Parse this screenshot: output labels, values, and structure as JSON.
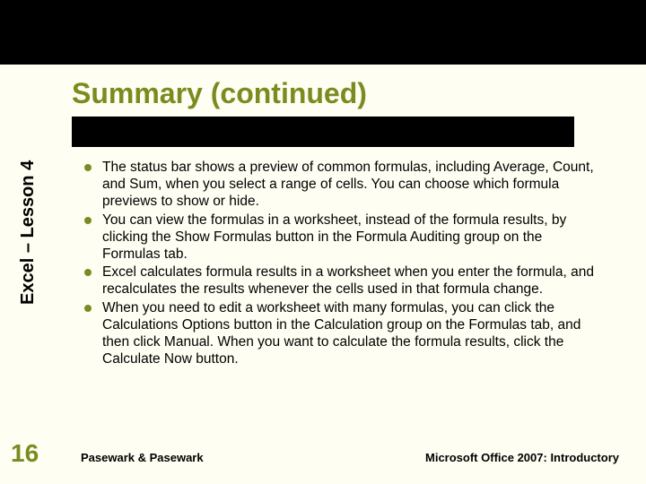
{
  "title": "Summary (continued)",
  "side_label": "Excel – Lesson 4",
  "bullets": [
    "The status bar shows a preview of common formulas, including Average, Count, and Sum, when you select a range of cells. You can choose which formula previews to show or hide.",
    "You can view the formulas in a worksheet, instead of the formula results, by clicking the Show Formulas button in the Formula Auditing group on the Formulas tab.",
    "Excel calculates formula results in a worksheet when you enter the formula, and recalculates the results whenever the cells used in that formula change.",
    "When you need to edit a worksheet with many formulas, you can click the Calculations Options button in the Calculation group on the Formulas tab, and then click Manual. When you want to calculate the formula results, click the Calculate Now button."
  ],
  "slide_number": "16",
  "footer_left": "Pasewark & Pasewark",
  "footer_right": "Microsoft Office 2007:  Introductory"
}
